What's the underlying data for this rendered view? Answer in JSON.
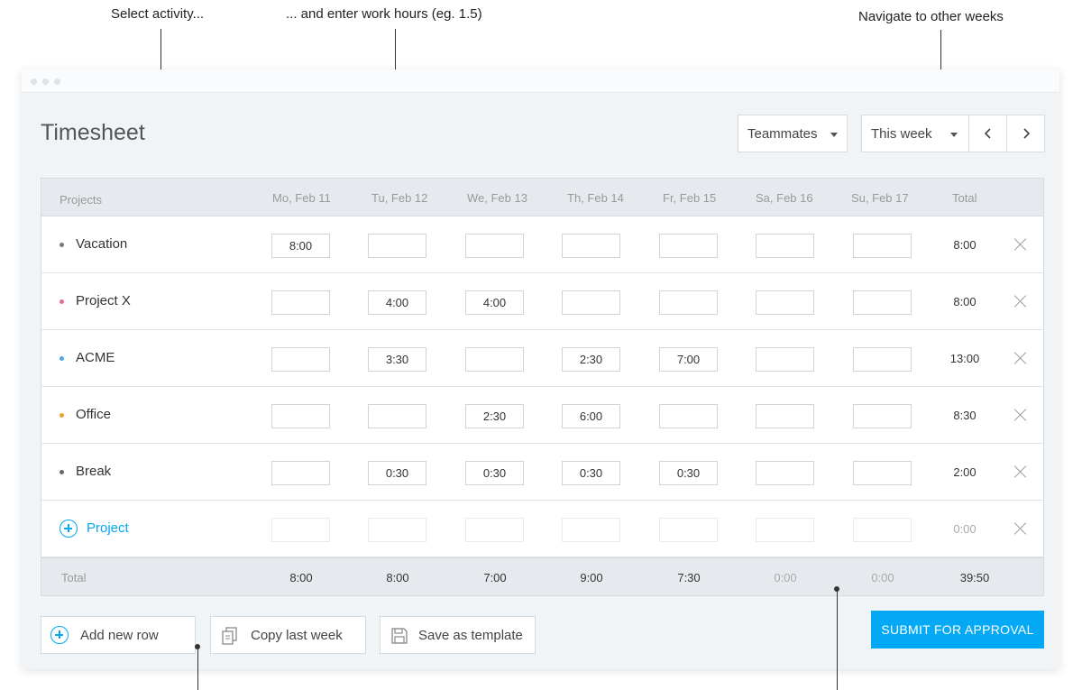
{
  "annotations": {
    "select_activity": "Select activity...",
    "enter_hours": "... and enter work hours (eg. 1.5)",
    "navigate_weeks": "Navigate to other weeks"
  },
  "page": {
    "title": "Timesheet"
  },
  "toolbar": {
    "teammates_label": "Teammates",
    "week_label": "This week"
  },
  "table": {
    "header": {
      "projects": "Projects",
      "days": [
        "Mo, Feb 11",
        "Tu, Feb 12",
        "We, Feb 13",
        "Th, Feb 14",
        "Fr, Feb 15",
        "Sa, Feb 16",
        "Su, Feb 17"
      ],
      "total": "Total"
    },
    "rows": [
      {
        "name": "Vacation",
        "color": "#777777",
        "hours": [
          "8:00",
          "",
          "",
          "",
          "",
          "",
          ""
        ],
        "total": "8:00"
      },
      {
        "name": "Project X",
        "color": "#e26d8e",
        "hours": [
          "",
          "4:00",
          "4:00",
          "",
          "",
          "",
          ""
        ],
        "total": "8:00"
      },
      {
        "name": "ACME",
        "color": "#4fa3e0",
        "hours": [
          "",
          "3:30",
          "",
          "2:30",
          "7:00",
          "",
          ""
        ],
        "total": "13:00"
      },
      {
        "name": "Office",
        "color": "#f0a030",
        "hours": [
          "",
          "",
          "2:30",
          "6:00",
          "",
          "",
          ""
        ],
        "total": "8:30"
      },
      {
        "name": "Break",
        "color": "#666666",
        "hours": [
          "",
          "0:30",
          "0:30",
          "0:30",
          "0:30",
          "",
          ""
        ],
        "total": "2:00"
      }
    ],
    "add_project": {
      "label": "Project",
      "total": "0:00"
    },
    "footer": {
      "label": "Total",
      "days": [
        "8:00",
        "8:00",
        "7:00",
        "9:00",
        "7:30",
        "0:00",
        "0:00"
      ],
      "total": "39:50"
    }
  },
  "actions": {
    "add_row": "Add new row",
    "copy_last_week": "Copy last week",
    "save_template": "Save as template",
    "submit": "SUBMIT FOR APPROVAL"
  },
  "colors": {
    "accent": "#03a9f4"
  }
}
